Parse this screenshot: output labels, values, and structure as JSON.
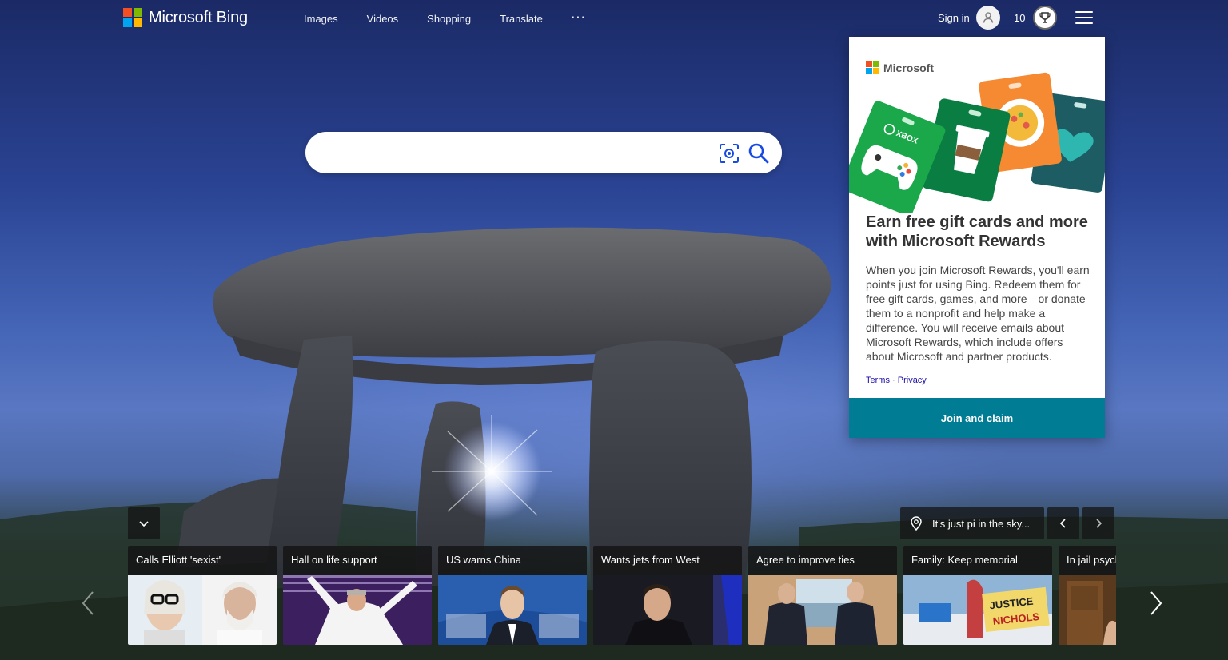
{
  "header": {
    "logo_text": "Microsoft Bing",
    "logo_colors": [
      "#f25022",
      "#7fba00",
      "#00a4ef",
      "#ffb900"
    ],
    "nav": [
      {
        "label": "Images"
      },
      {
        "label": "Videos"
      },
      {
        "label": "Shopping"
      },
      {
        "label": "Translate"
      },
      {
        "label": "···"
      }
    ],
    "sign_in_label": "Sign in",
    "rewards_points": "10",
    "avatar_icon": "person-icon",
    "rewards_icon": "trophy-icon",
    "menu_icon": "hamburger-icon"
  },
  "search": {
    "value": "",
    "placeholder": "",
    "visual_search_icon": "camera-scan-icon",
    "search_icon": "magnifier-icon"
  },
  "rewards_flyout": {
    "brand": "Microsoft",
    "title": "Earn free gift cards and more with Microsoft Rewards",
    "body": "When you join Microsoft Rewards, you'll earn points just for using Bing. Redeem them for free gift cards, games, and more—or donate them to a nonprofit and help make a difference. You will receive emails about Microsoft Rewards, which include offers about Microsoft and partner products.",
    "terms_label": "Terms",
    "separator": "·",
    "privacy_label": "Privacy",
    "cta_label": "Join and claim",
    "card_xbox_label": "XBOX",
    "colors": {
      "cta": "#007c95",
      "xbox": "#1aa84a",
      "coffee": "#0a7d43",
      "food": "#f68a32",
      "heart": "#1e5c63"
    }
  },
  "image_info": {
    "caption": "It's just pi in the sky...",
    "location_icon": "location-pin-icon"
  },
  "news": [
    {
      "caption": "Calls Elliott 'sexist'"
    },
    {
      "caption": "Hall on life support"
    },
    {
      "caption": "US warns China"
    },
    {
      "caption": "Wants jets from West"
    },
    {
      "caption": "Agree to improve ties"
    },
    {
      "caption": "Family: Keep memorial"
    },
    {
      "caption": "In jail psych"
    }
  ]
}
